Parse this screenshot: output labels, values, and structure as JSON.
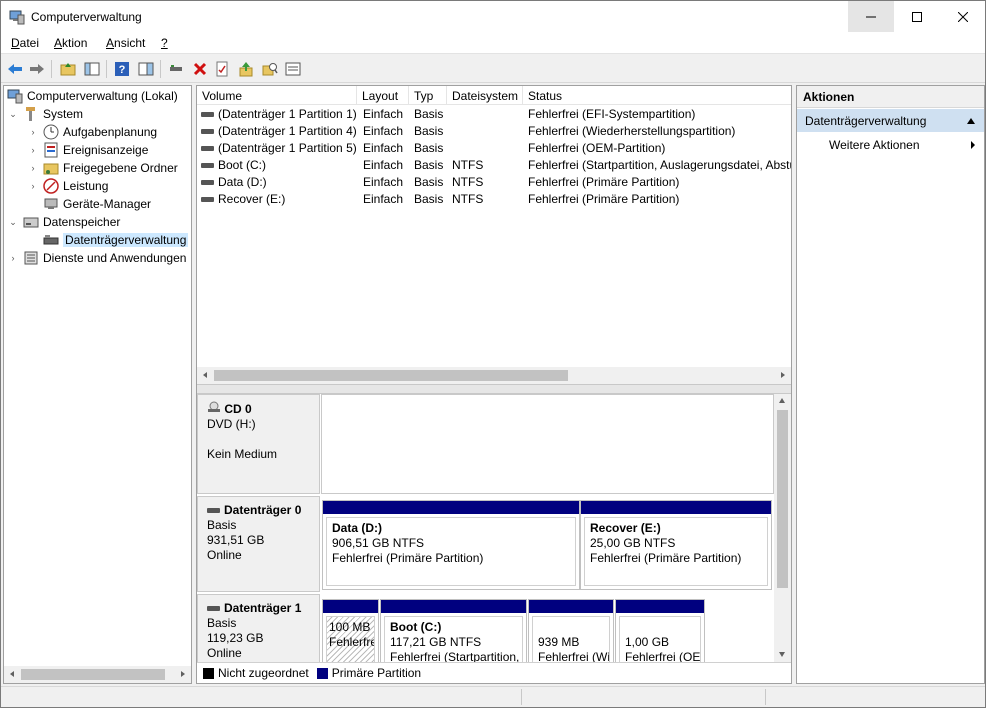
{
  "window": {
    "title": "Computerverwaltung"
  },
  "menu": [
    {
      "label": "Datei",
      "u": "D",
      "rest": "atei"
    },
    {
      "label": "Aktion",
      "u": "A",
      "rest": "ktion"
    },
    {
      "label": "Ansicht",
      "u": "A",
      "rest": "nsicht"
    },
    {
      "label": "?",
      "u": "?",
      "rest": ""
    }
  ],
  "toolbar": {
    "icons": [
      "back-arrow-icon",
      "forward-arrow-icon",
      "up-folder-icon",
      "show-hide-tree-icon",
      "help-icon",
      "console-icon",
      "connect-icon",
      "delete-icon",
      "properties-icon",
      "export-up-icon",
      "search-icon",
      "list-icon"
    ]
  },
  "tree": {
    "root": "Computerverwaltung (Lokal)",
    "system": "System",
    "items": [
      "Aufgabenplanung",
      "Ereignisanzeige",
      "Freigegebene Ordner",
      "Leistung",
      "Geräte-Manager"
    ],
    "storage": "Datenspeicher",
    "disk_mgmt": "Datenträgerverwaltung",
    "services": "Dienste und Anwendungen"
  },
  "volumes": {
    "headers": [
      "Volume",
      "Layout",
      "Typ",
      "Dateisystem",
      "Status"
    ],
    "rows": [
      {
        "volume": "(Datenträger 1 Partition 1)",
        "layout": "Einfach",
        "type": "Basis",
        "fs": "",
        "status": "Fehlerfrei (EFI-Systempartition)"
      },
      {
        "volume": "(Datenträger 1 Partition 4)",
        "layout": "Einfach",
        "type": "Basis",
        "fs": "",
        "status": "Fehlerfrei (Wiederherstellungspartition)"
      },
      {
        "volume": "(Datenträger 1 Partition 5)",
        "layout": "Einfach",
        "type": "Basis",
        "fs": "",
        "status": "Fehlerfrei (OEM-Partition)"
      },
      {
        "volume": "Boot (C:)",
        "layout": "Einfach",
        "type": "Basis",
        "fs": "NTFS",
        "status": "Fehlerfrei (Startpartition, Auslagerungsdatei, Absturzabbild, Primäre Partition)"
      },
      {
        "volume": "Data (D:)",
        "layout": "Einfach",
        "type": "Basis",
        "fs": "NTFS",
        "status": "Fehlerfrei (Primäre Partition)"
      },
      {
        "volume": "Recover (E:)",
        "layout": "Einfach",
        "type": "Basis",
        "fs": "NTFS",
        "status": "Fehlerfrei (Primäre Partition)"
      }
    ]
  },
  "disks": {
    "cd0": {
      "name": "CD 0",
      "type": "DVD (H:)",
      "media": "Kein Medium"
    },
    "disk0": {
      "name": "Datenträger 0",
      "kind": "Basis",
      "size": "931,51 GB",
      "state": "Online",
      "parts": [
        {
          "name": "Data  (D:)",
          "size": "906,51 GB NTFS",
          "status": "Fehlerfrei (Primäre Partition)"
        },
        {
          "name": "Recover  (E:)",
          "size": "25,00 GB NTFS",
          "status": "Fehlerfrei (Primäre Partition)"
        }
      ]
    },
    "disk1": {
      "name": "Datenträger 1",
      "kind": "Basis",
      "size": "119,23 GB",
      "state": "Online",
      "parts": [
        {
          "name": "",
          "size": "100 MB",
          "status": "Fehlerfrei"
        },
        {
          "name": "Boot  (C:)",
          "size": "117,21 GB NTFS",
          "status": "Fehlerfrei (Startpartition, Auslagerungsdatei, Absturzabbild, Primäre Partition)"
        },
        {
          "name": "",
          "size": "939 MB",
          "status": "Fehlerfrei (Wiederherstellungspartition)"
        },
        {
          "name": "",
          "size": "1,00 GB",
          "status": "Fehlerfrei (OEM-Partition)"
        }
      ]
    }
  },
  "legend": {
    "unallocated": "Nicht zugeordnet",
    "primary": "Primäre Partition",
    "unallocated_color": "#000000",
    "primary_color": "#00007f"
  },
  "actions": {
    "title": "Aktionen",
    "section": "Datenträgerverwaltung",
    "more": "Weitere Aktionen"
  }
}
